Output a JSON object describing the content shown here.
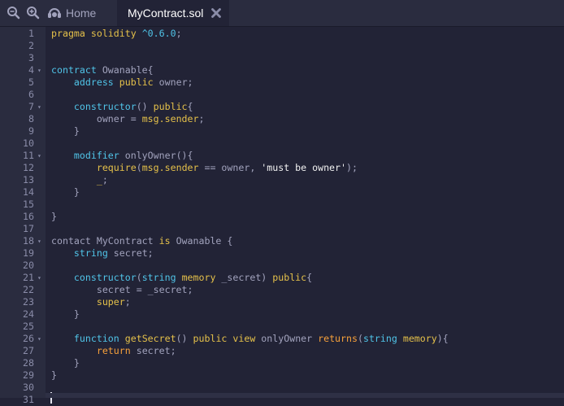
{
  "tabs": {
    "home_label": "Home",
    "active_label": "MyContract.sol"
  },
  "icons": {
    "zoom_out": "zoom-out-icon",
    "zoom_in": "zoom-in-icon",
    "home": "remix-home-icon",
    "close": "close-icon"
  },
  "colors": {
    "background": "#222336",
    "gutter": "#2a2c3f",
    "keyword_yellow": "#e5c14a",
    "keyword_blue": "#50c4e8",
    "keyword_orange": "#f8a13b",
    "text": "#a2a3bd"
  },
  "editor": {
    "lines": [
      {
        "n": "1",
        "fold": false,
        "tokens": [
          {
            "t": "pragma solidity ",
            "c": "y"
          },
          {
            "t": "^0.6.0",
            "c": "b"
          },
          {
            "t": ";",
            "c": ""
          }
        ]
      },
      {
        "n": "2",
        "fold": false,
        "tokens": []
      },
      {
        "n": "3",
        "fold": false,
        "tokens": []
      },
      {
        "n": "4",
        "fold": true,
        "tokens": [
          {
            "t": "contract",
            "c": "b"
          },
          {
            "t": " Owanable{",
            "c": ""
          }
        ]
      },
      {
        "n": "5",
        "fold": false,
        "tokens": [
          {
            "t": "    ",
            "c": ""
          },
          {
            "t": "address",
            "c": "b"
          },
          {
            "t": " ",
            "c": ""
          },
          {
            "t": "public",
            "c": "y"
          },
          {
            "t": " owner;",
            "c": ""
          }
        ]
      },
      {
        "n": "6",
        "fold": false,
        "tokens": []
      },
      {
        "n": "7",
        "fold": true,
        "tokens": [
          {
            "t": "    ",
            "c": ""
          },
          {
            "t": "constructor",
            "c": "b"
          },
          {
            "t": "() ",
            "c": ""
          },
          {
            "t": "public",
            "c": "y"
          },
          {
            "t": "{",
            "c": ""
          }
        ]
      },
      {
        "n": "8",
        "fold": false,
        "tokens": [
          {
            "t": "        owner = ",
            "c": ""
          },
          {
            "t": "msg.sender",
            "c": "y"
          },
          {
            "t": ";",
            "c": ""
          }
        ]
      },
      {
        "n": "9",
        "fold": false,
        "tokens": [
          {
            "t": "    }",
            "c": ""
          }
        ]
      },
      {
        "n": "10",
        "fold": false,
        "tokens": []
      },
      {
        "n": "11",
        "fold": true,
        "tokens": [
          {
            "t": "    ",
            "c": ""
          },
          {
            "t": "modifier",
            "c": "b"
          },
          {
            "t": " onlyOwner(){",
            "c": ""
          }
        ]
      },
      {
        "n": "12",
        "fold": false,
        "tokens": [
          {
            "t": "        ",
            "c": ""
          },
          {
            "t": "require",
            "c": "y"
          },
          {
            "t": "(",
            "c": ""
          },
          {
            "t": "msg.sender",
            "c": "y"
          },
          {
            "t": " == owner, ",
            "c": ""
          },
          {
            "t": "'must be owner'",
            "c": "s"
          },
          {
            "t": ");",
            "c": ""
          }
        ]
      },
      {
        "n": "13",
        "fold": false,
        "tokens": [
          {
            "t": "        ",
            "c": ""
          },
          {
            "t": "_",
            "c": "y"
          },
          {
            "t": ";",
            "c": ""
          }
        ]
      },
      {
        "n": "14",
        "fold": false,
        "tokens": [
          {
            "t": "    }",
            "c": ""
          }
        ]
      },
      {
        "n": "15",
        "fold": false,
        "tokens": []
      },
      {
        "n": "16",
        "fold": false,
        "tokens": [
          {
            "t": "}",
            "c": ""
          }
        ]
      },
      {
        "n": "17",
        "fold": false,
        "tokens": []
      },
      {
        "n": "18",
        "fold": true,
        "tokens": [
          {
            "t": "contact MyContract ",
            "c": ""
          },
          {
            "t": "is",
            "c": "y"
          },
          {
            "t": " Owanable {",
            "c": ""
          }
        ]
      },
      {
        "n": "19",
        "fold": false,
        "tokens": [
          {
            "t": "    ",
            "c": ""
          },
          {
            "t": "string",
            "c": "b"
          },
          {
            "t": " secret;",
            "c": ""
          }
        ]
      },
      {
        "n": "20",
        "fold": false,
        "tokens": []
      },
      {
        "n": "21",
        "fold": true,
        "tokens": [
          {
            "t": "    ",
            "c": ""
          },
          {
            "t": "constructor",
            "c": "b"
          },
          {
            "t": "(",
            "c": ""
          },
          {
            "t": "string",
            "c": "b"
          },
          {
            "t": " ",
            "c": ""
          },
          {
            "t": "memory",
            "c": "y"
          },
          {
            "t": " _secret) ",
            "c": ""
          },
          {
            "t": "public",
            "c": "y"
          },
          {
            "t": "{",
            "c": ""
          }
        ]
      },
      {
        "n": "22",
        "fold": false,
        "tokens": [
          {
            "t": "        secret = _secret;",
            "c": ""
          }
        ]
      },
      {
        "n": "23",
        "fold": false,
        "tokens": [
          {
            "t": "        ",
            "c": ""
          },
          {
            "t": "super",
            "c": "y"
          },
          {
            "t": ";",
            "c": ""
          }
        ]
      },
      {
        "n": "24",
        "fold": false,
        "tokens": [
          {
            "t": "    }",
            "c": ""
          }
        ]
      },
      {
        "n": "25",
        "fold": false,
        "tokens": []
      },
      {
        "n": "26",
        "fold": true,
        "tokens": [
          {
            "t": "    ",
            "c": ""
          },
          {
            "t": "function",
            "c": "b"
          },
          {
            "t": " ",
            "c": ""
          },
          {
            "t": "getSecret",
            "c": "y"
          },
          {
            "t": "() ",
            "c": ""
          },
          {
            "t": "public",
            "c": "y"
          },
          {
            "t": " ",
            "c": ""
          },
          {
            "t": "view",
            "c": "y"
          },
          {
            "t": " onlyOwner ",
            "c": ""
          },
          {
            "t": "returns",
            "c": "o"
          },
          {
            "t": "(",
            "c": ""
          },
          {
            "t": "string",
            "c": "b"
          },
          {
            "t": " ",
            "c": ""
          },
          {
            "t": "memory",
            "c": "y"
          },
          {
            "t": "){",
            "c": ""
          }
        ]
      },
      {
        "n": "27",
        "fold": false,
        "tokens": [
          {
            "t": "        ",
            "c": ""
          },
          {
            "t": "return",
            "c": "o"
          },
          {
            "t": " secret;",
            "c": ""
          }
        ]
      },
      {
        "n": "28",
        "fold": false,
        "tokens": [
          {
            "t": "    }",
            "c": ""
          }
        ]
      },
      {
        "n": "29",
        "fold": false,
        "tokens": [
          {
            "t": "}",
            "c": ""
          }
        ]
      },
      {
        "n": "30",
        "fold": false,
        "tokens": []
      },
      {
        "n": "31",
        "fold": false,
        "tokens": []
      }
    ]
  }
}
